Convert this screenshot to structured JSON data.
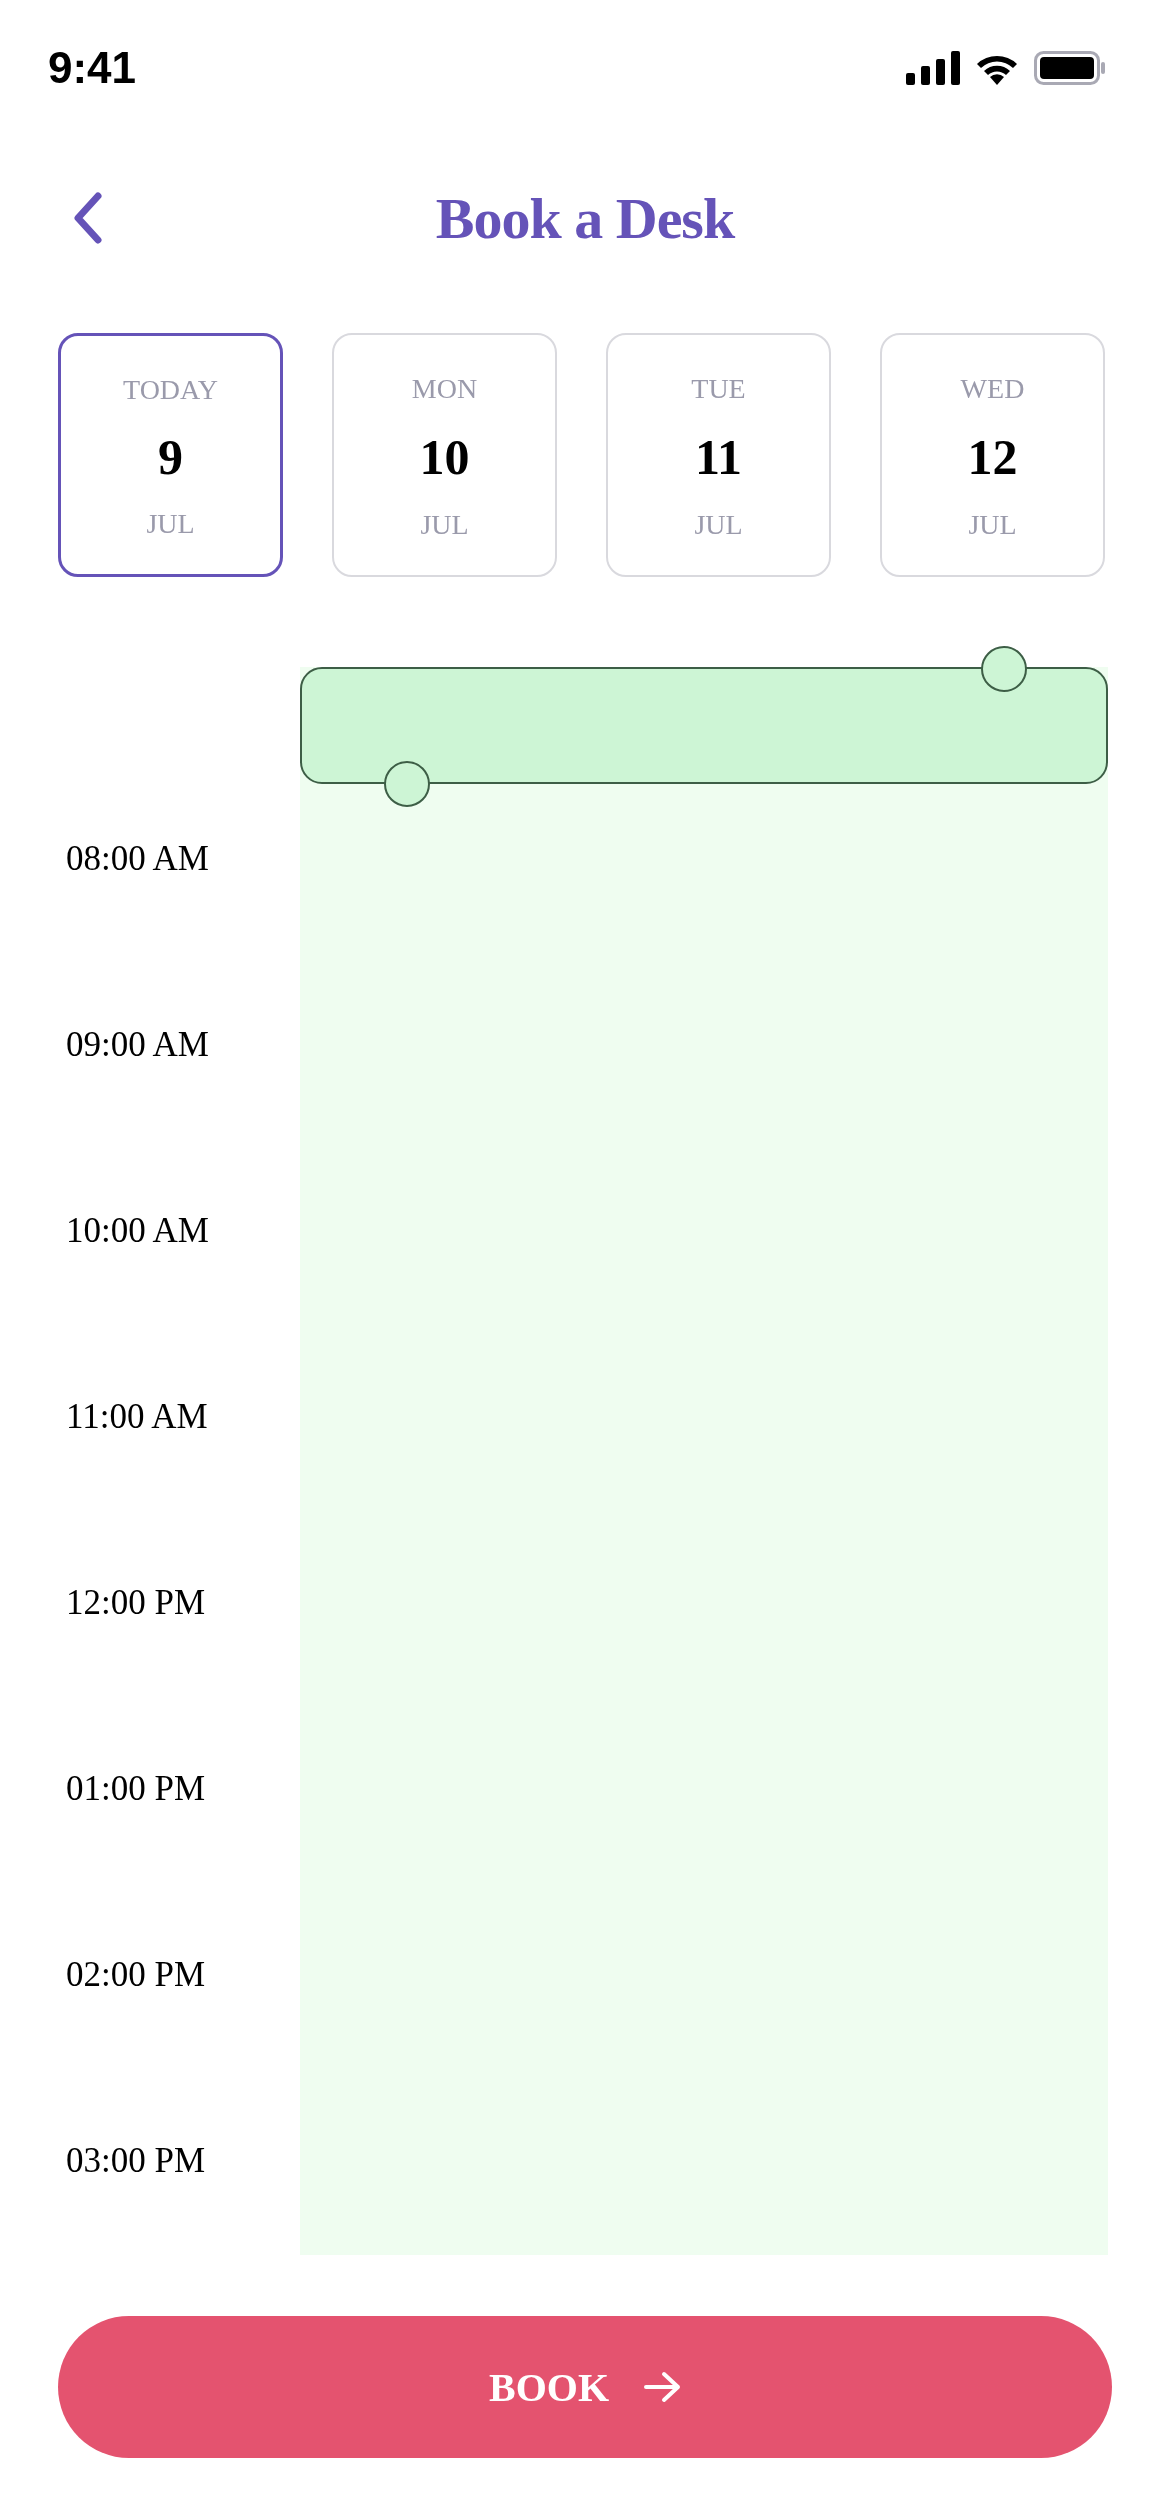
{
  "status_bar": {
    "time": "9:41"
  },
  "header": {
    "title": "Book a Desk"
  },
  "days": [
    {
      "weekday": "TODAY",
      "day": "9",
      "month": "JUL",
      "selected": true
    },
    {
      "weekday": "MON",
      "day": "10",
      "month": "JUL",
      "selected": false
    },
    {
      "weekday": "TUE",
      "day": "11",
      "month": "JUL",
      "selected": false
    },
    {
      "weekday": "WED",
      "day": "12",
      "month": "JUL",
      "selected": false
    }
  ],
  "timeline": {
    "hours": [
      "08:00 AM",
      "09:00 AM",
      "10:00 AM",
      "11:00 AM",
      "12:00 PM",
      "01:00 PM",
      "02:00 PM",
      "03:00 PM"
    ]
  },
  "book_button": {
    "label": "BOOK"
  }
}
